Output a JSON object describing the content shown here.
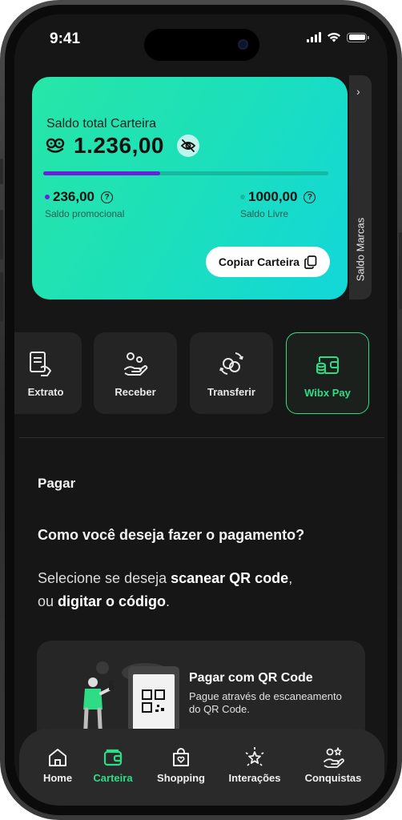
{
  "status_bar": {
    "time": "9:41"
  },
  "wallet": {
    "title": "Saldo total Carteira",
    "total": "1.236,00",
    "progress": 0.41,
    "promo_amount": "236,00",
    "promo_label": "Saldo promocional",
    "free_amount": "1000,00",
    "free_label": "Saldo Livre",
    "help_symbol": "?",
    "copy_label": "Copiar Carteira",
    "accent_promo": "#6a1fd8",
    "accent_free": "#16b8a0"
  },
  "brands_tab": {
    "label": "Saldo Marcas",
    "chevron": "›"
  },
  "actions": [
    {
      "label": "Extrato",
      "icon": "receipt-hand-icon"
    },
    {
      "label": "Receber",
      "icon": "receive-hand-icon"
    },
    {
      "label": "Transferir",
      "icon": "transfer-coins-icon"
    },
    {
      "label": "Wibx Pay",
      "icon": "wallet-coins-icon"
    }
  ],
  "pay": {
    "heading": "Pagar",
    "question": "Como você deseja fazer o pagamento?",
    "desc_1": "Selecione se deseja ",
    "desc_1_bold": "scanear QR code",
    "desc_1_end": ",",
    "desc_2": "ou ",
    "desc_2_bold": "digitar o código",
    "desc_2_end": "."
  },
  "qr_card": {
    "title": "Pagar com QR Code",
    "subtitle": "Pague através de escaneamento do QR Code."
  },
  "nav": [
    {
      "label": "Home",
      "icon": "home-icon"
    },
    {
      "label": "Carteira",
      "icon": "wallet-icon",
      "active": true
    },
    {
      "label": "Shopping",
      "icon": "shopping-bag-icon"
    },
    {
      "label": "Interações",
      "icon": "sparkle-star-icon"
    },
    {
      "label": "Conquistas",
      "icon": "achievement-hand-icon"
    }
  ],
  "colors": {
    "brand_green": "#2fdc86",
    "card_start": "#27e6a7",
    "card_end": "#12d7d9",
    "screen_bg": "#161616"
  }
}
